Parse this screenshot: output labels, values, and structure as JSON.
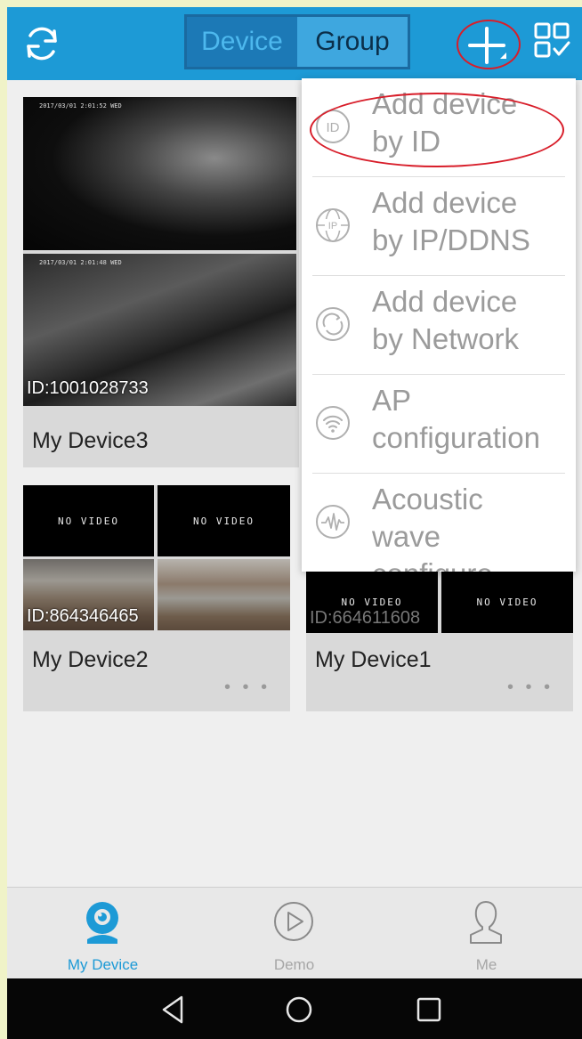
{
  "colors": {
    "topbar": "#1d9ad6",
    "segment_active_text": "#4db8ee",
    "segment_inactive_text": "#0b2f4a",
    "annotation_red": "#d81e2a",
    "nav_active": "#1d9ad6",
    "nav_inactive": "#a6a6a6",
    "menu_text": "#9b9b9b"
  },
  "topbar": {
    "refresh_icon": "refresh-icon",
    "segments": [
      {
        "label": "Device",
        "active": true
      },
      {
        "label": "Group",
        "active": false
      }
    ],
    "add_icon": "plus-icon",
    "qr_icon": "qr-scan-icon"
  },
  "add_menu": {
    "items": [
      {
        "label": "Add device\nby ID",
        "icon": "id-icon"
      },
      {
        "label": "Add device\nby IP/DDNS",
        "icon": "globe-ip-icon"
      },
      {
        "label": "Add device\nby Network",
        "icon": "network-icon"
      },
      {
        "label": "AP\nconfiguration",
        "icon": "wifi-icon"
      },
      {
        "label": "Acoustic\nwave\nconfigure",
        "icon": "sound-wave-icon"
      }
    ]
  },
  "devices": [
    {
      "name": "My Device3",
      "id_label": "ID:1001028733",
      "timestamps": [
        "2017/03/01 2:01:52 WED",
        "2017/03/01 2:01:48 WED"
      ]
    },
    {
      "name": "My Device2",
      "id_label": "ID:864346465",
      "tiles": [
        "NO VIDEO",
        "NO VIDEO"
      ],
      "more": "• • •"
    },
    {
      "name": "My Device1",
      "id_label": "ID:664611608",
      "tiles": [
        "NO VIDEO",
        "NO VIDEO"
      ],
      "more": "• • •"
    }
  ],
  "bottom_nav": {
    "tabs": [
      {
        "label": "My Device",
        "icon": "camera-icon",
        "active": true
      },
      {
        "label": "Demo",
        "icon": "play-icon",
        "active": false
      },
      {
        "label": "Me",
        "icon": "person-icon",
        "active": false
      }
    ]
  },
  "system_nav": {
    "buttons": [
      "back-icon",
      "home-icon",
      "recents-icon"
    ]
  }
}
